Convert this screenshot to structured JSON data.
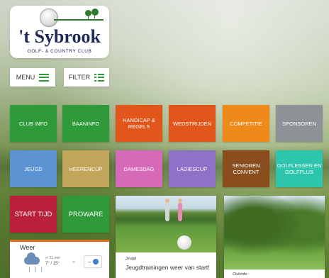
{
  "logo": {
    "title": "'t Sybrook",
    "subtitle": "GOLF- & COUNTRY CLUB"
  },
  "nav": {
    "menu_label": "MENU",
    "filter_label": "FILTER"
  },
  "tiles": [
    {
      "label": "CLUB INFO",
      "color": "#2e9a3a"
    },
    {
      "label": "BAANINFO",
      "color": "#2e9a3a"
    },
    {
      "label": "HANDICAP & REGELS",
      "color": "#e2561c"
    },
    {
      "label": "WEDSTRIJDEN",
      "color": "#e2561c"
    },
    {
      "label": "COMPETITIE",
      "color": "#ef8a1a"
    },
    {
      "label": "SPONSOREN",
      "color": "#8e9297"
    },
    {
      "label": "JEUGD",
      "color": "#5b93d3"
    },
    {
      "label": "HEERENCUP",
      "color": "#c1a55a"
    },
    {
      "label": "DAMESDAG",
      "color": "#d76ab8"
    },
    {
      "label": "LADIESCUP",
      "color": "#8f72c7"
    },
    {
      "label": "SENIOREN CONVENT",
      "color": "#8a4e1e"
    },
    {
      "label": "GOLFLESSEN EN GOLFPLUS",
      "color": "#2ec5ad"
    },
    {
      "label": "START TIJD",
      "color": "#b9203a"
    },
    {
      "label": "PROWARE",
      "color": "#2e9a3a"
    }
  ],
  "weather": {
    "title": "Weer",
    "day": "vr 21 mei",
    "temp": "7° / 15°",
    "accent": "#e86c1a"
  },
  "news": [
    {
      "category": "Jeugd",
      "title": "Jeugdtrainingen weer van start!"
    },
    {
      "category": "ClubInfo"
    }
  ]
}
